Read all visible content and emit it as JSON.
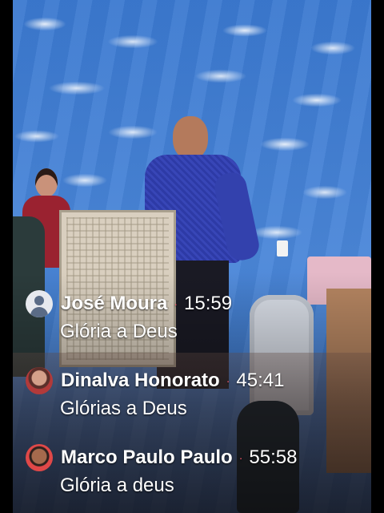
{
  "comments": [
    {
      "name": "José Moura",
      "time": "15:59",
      "message": "Glória a Deus",
      "avatar": "default-avatar-icon"
    },
    {
      "name": "Dinalva Honorato",
      "time": "45:41",
      "message": "Glórias a Deus",
      "avatar": "profile-photo"
    },
    {
      "name": "Marco Paulo Paulo",
      "time": "55:58",
      "message": "Glória a deus",
      "avatar": "profile-photo"
    }
  ],
  "separator": "·",
  "colors": {
    "wall": "#3f7fd1",
    "text": "#ffffff",
    "dot": "#ff5b6e"
  }
}
